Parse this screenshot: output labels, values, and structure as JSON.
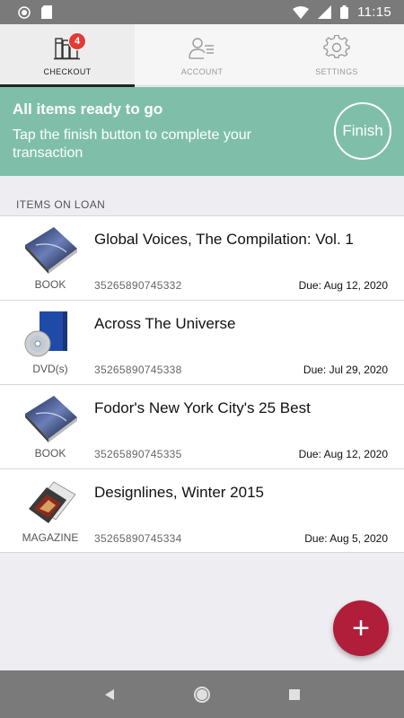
{
  "status_bar": {
    "time": "11:15",
    "icons": [
      "circle-icon",
      "sd-card-icon",
      "wifi-icon",
      "signal-icon",
      "battery-icon"
    ]
  },
  "tabs": [
    {
      "label": "CHECKOUT",
      "icon": "books-icon",
      "badge": "4",
      "active": true
    },
    {
      "label": "ACCOUNT",
      "icon": "person-list-icon",
      "active": false
    },
    {
      "label": "SETTINGS",
      "icon": "gear-icon",
      "active": false
    }
  ],
  "banner": {
    "title": "All items ready to go",
    "message": "Tap the finish button to complete your transaction",
    "finish_label": "Finish",
    "color": "#7fbfaa"
  },
  "section": {
    "header": "ITEMS ON LOAN"
  },
  "items": [
    {
      "title": "Global Voices, The Compilation: Vol. 1",
      "format": "BOOK",
      "barcode": "35265890745332",
      "due": "Due: Aug 12, 2020",
      "thumb": "book-thumbnail"
    },
    {
      "title": "Across The Universe",
      "format": "DVD(s)",
      "barcode": "35265890745338",
      "due": "Due: Jul 29, 2020",
      "thumb": "dvd-thumbnail"
    },
    {
      "title": "Fodor's New York City's 25 Best",
      "format": "BOOK",
      "barcode": "35265890745335",
      "due": "Due: Aug 12, 2020",
      "thumb": "book-thumbnail"
    },
    {
      "title": "Designlines, Winter 2015",
      "format": "MAGAZINE",
      "barcode": "35265890745334",
      "due": "Due: Aug 5, 2020",
      "thumb": "magazine-thumbnail"
    }
  ],
  "fab": {
    "label": "+",
    "color": "#b01e3a"
  },
  "nav": {
    "icons": [
      "back-icon",
      "home-icon",
      "recents-icon"
    ]
  }
}
